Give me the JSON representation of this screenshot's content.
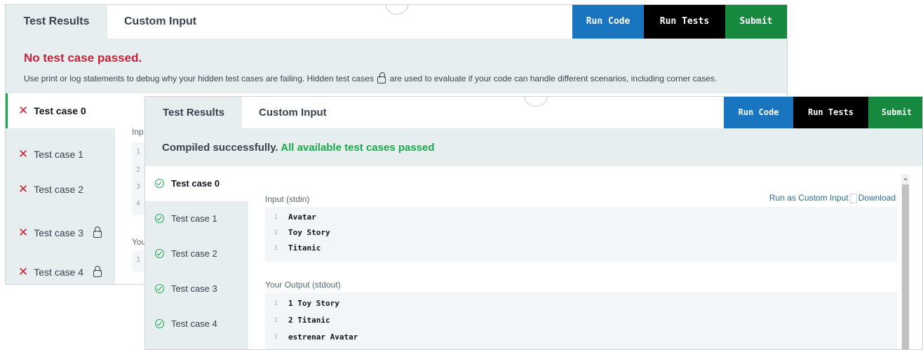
{
  "back_panel": {
    "tabs": [
      "Test Results",
      "Custom Input"
    ],
    "buttons": {
      "run_code": "Run Code",
      "run_tests": "Run Tests",
      "submit": "Submit"
    },
    "status_title": "No test case passed.",
    "status_desc_before": "Use print or log statements to debug why your hidden test cases are failing. Hidden test cases",
    "status_desc_after": "are used to evaluate if your code can handle different scenarios, including corner cases.",
    "test_cases": [
      {
        "label": "Test case 0",
        "locked": false
      },
      {
        "label": "Test case 1",
        "locked": false
      },
      {
        "label": "Test case 2",
        "locked": false
      },
      {
        "label": "Test case 3",
        "locked": true
      },
      {
        "label": "Test case 4",
        "locked": true
      }
    ],
    "fragments": {
      "input": "Inp",
      "output": "You"
    },
    "fragment_line_numbers": [
      "1",
      "2",
      "3",
      "4"
    ]
  },
  "front_panel": {
    "tabs": [
      "Test Results",
      "Custom Input"
    ],
    "buttons": {
      "run_code": "Run Code",
      "run_tests": "Run Tests",
      "submit": "Submit"
    },
    "status_prefix": "Compiled successfully.",
    "status_suffix": "All available test cases passed",
    "test_cases": [
      "Test case 0",
      "Test case 1",
      "Test case 2",
      "Test case 3",
      "Test case 4"
    ],
    "input_label": "Input (stdin)",
    "run_custom_link": "Run as Custom Input",
    "download_link": "Download",
    "input_lines": [
      {
        "n": "1",
        "text": "Avatar"
      },
      {
        "n": "2",
        "text": "Toy Story"
      },
      {
        "n": "3",
        "text": "Titanic"
      }
    ],
    "output_label": "Your Output (stdout)",
    "output_lines": [
      {
        "n": "1",
        "text": "1 Toy Story"
      },
      {
        "n": "2",
        "text": "2 Titanic"
      },
      {
        "n": "3",
        "text": "estrenar Avatar"
      }
    ]
  },
  "colors": {
    "run_code": "#1a75c0",
    "run_tests": "#000000",
    "submit": "#17893e",
    "fail": "#cc1f36",
    "pass": "#1ba94c"
  }
}
